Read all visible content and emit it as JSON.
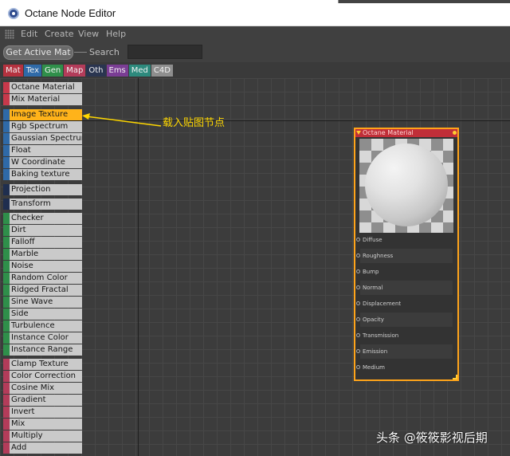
{
  "window": {
    "title": "Octane Node Editor"
  },
  "menu": [
    "Edit",
    "Create",
    "View",
    "Help"
  ],
  "toolbar": {
    "get_active_mat_label": "Get Active Mat",
    "search_label": "Search",
    "search_value": ""
  },
  "tabs": [
    {
      "label": "Mat",
      "color": "#b5323f"
    },
    {
      "label": "Tex",
      "color": "#2f6aa8"
    },
    {
      "label": "Gen",
      "color": "#2f8f4a"
    },
    {
      "label": "Map",
      "color": "#b33c5a"
    },
    {
      "label": "Oth",
      "color": "#2a3550"
    },
    {
      "label": "Ems",
      "color": "#7a3d94"
    },
    {
      "label": "Med",
      "color": "#2d8a7d"
    },
    {
      "label": "C4D",
      "color": "#8e8e8e"
    }
  ],
  "node_list": [
    {
      "label": "Octane Material",
      "category": "mat"
    },
    {
      "label": "Mix Material",
      "category": "mat"
    },
    {
      "label": "Image Texture",
      "category": "tex",
      "selected": true
    },
    {
      "label": "Rgb Spectrum",
      "category": "tex"
    },
    {
      "label": "Gaussian Spectrum",
      "category": "tex"
    },
    {
      "label": "Float",
      "category": "tex"
    },
    {
      "label": "W Coordinate",
      "category": "tex"
    },
    {
      "label": "Baking texture",
      "category": "tex"
    },
    {
      "label": "Projection",
      "category": "proj"
    },
    {
      "label": "Transform",
      "category": "proj"
    },
    {
      "label": "Checker",
      "category": "gen"
    },
    {
      "label": "Dirt",
      "category": "gen"
    },
    {
      "label": "Falloff",
      "category": "gen"
    },
    {
      "label": "Marble",
      "category": "gen"
    },
    {
      "label": "Noise",
      "category": "gen"
    },
    {
      "label": "Random Color",
      "category": "gen"
    },
    {
      "label": "Ridged Fractal",
      "category": "gen"
    },
    {
      "label": "Sine Wave",
      "category": "gen"
    },
    {
      "label": "Side",
      "category": "gen"
    },
    {
      "label": "Turbulence",
      "category": "gen"
    },
    {
      "label": "Instance Color",
      "category": "gen"
    },
    {
      "label": "Instance Range",
      "category": "gen"
    },
    {
      "label": "Clamp Texture",
      "category": "map"
    },
    {
      "label": "Color Correction",
      "category": "map"
    },
    {
      "label": "Cosine Mix",
      "category": "map"
    },
    {
      "label": "Gradient",
      "category": "map"
    },
    {
      "label": "Invert",
      "category": "map"
    },
    {
      "label": "Mix",
      "category": "map"
    },
    {
      "label": "Multiply",
      "category": "map"
    },
    {
      "label": "Add",
      "category": "map"
    }
  ],
  "annotation": {
    "text": "载入贴图节点"
  },
  "material_node": {
    "title": "Octane Material",
    "inputs": [
      "Diffuse",
      "Roughness",
      "Bump",
      "Normal",
      "Displacement",
      "Opacity",
      "Transmission",
      "Emission",
      "Medium"
    ]
  },
  "watermark": "头条 @筱筱影视后期"
}
